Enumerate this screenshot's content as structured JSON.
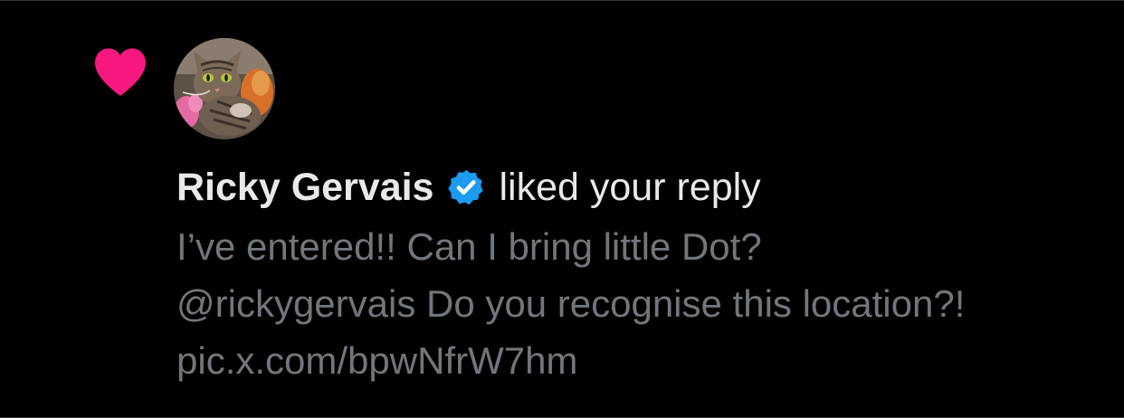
{
  "notification": {
    "author_name": "Ricky Gervais",
    "action": "liked your reply",
    "reply_lines": [
      "I’ve entered!! Can I bring little Dot?",
      "@rickygervais Do you recognise this location?!",
      "pic.x.com/bpwNfrW7hm"
    ],
    "icons": {
      "notification_type": "heart-icon",
      "verified": "verified-badge-icon"
    }
  },
  "colors": {
    "background": "#000000",
    "like_pink": "#f91880",
    "verified_blue": "#1d9bf0",
    "primary_text": "#e7e9ea",
    "secondary_text": "#71767b"
  }
}
